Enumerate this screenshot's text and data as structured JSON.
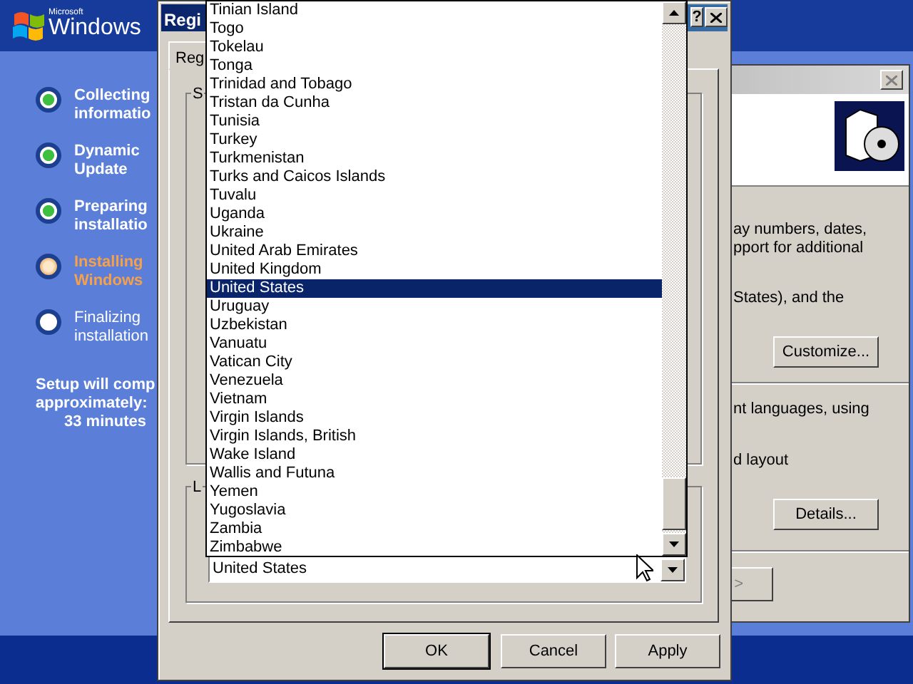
{
  "header": {
    "logo_small": "Microsoft",
    "logo": "Windows"
  },
  "steps": [
    {
      "lines": [
        "Collecting",
        "informatio"
      ],
      "kind": "done"
    },
    {
      "lines": [
        "Dynamic",
        "Update"
      ],
      "kind": "done"
    },
    {
      "lines": [
        "Preparing",
        "installatio"
      ],
      "kind": "done"
    },
    {
      "lines": [
        "Installing",
        "Windows"
      ],
      "kind": "current"
    },
    {
      "lines": [
        "Finalizing",
        "installation"
      ],
      "kind": "pending"
    }
  ],
  "estimate": [
    "Setup will comp",
    "approximately:",
    "33 minutes"
  ],
  "back_window": {
    "texts": [
      "ay numbers, dates,",
      "pport for additional",
      "States), and the"
    ],
    "customize": "Customize...",
    "texts2": [
      "nt languages, using",
      "d layout"
    ],
    "details": "Details...",
    "next": ">"
  },
  "dialog": {
    "title": "Regi",
    "help": "?",
    "tab": "Reg",
    "group_labels": [
      "S",
      "L"
    ],
    "combo_value": "United States",
    "list": [
      {
        "text": "Tinian Island",
        "selected": false
      },
      {
        "text": "Togo",
        "selected": false
      },
      {
        "text": "Tokelau",
        "selected": false
      },
      {
        "text": "Tonga",
        "selected": false
      },
      {
        "text": "Trinidad and Tobago",
        "selected": false
      },
      {
        "text": "Tristan da Cunha",
        "selected": false
      },
      {
        "text": "Tunisia",
        "selected": false
      },
      {
        "text": "Turkey",
        "selected": false
      },
      {
        "text": "Turkmenistan",
        "selected": false
      },
      {
        "text": "Turks and Caicos Islands",
        "selected": false
      },
      {
        "text": "Tuvalu",
        "selected": false
      },
      {
        "text": "Uganda",
        "selected": false
      },
      {
        "text": "Ukraine",
        "selected": false
      },
      {
        "text": "United Arab Emirates",
        "selected": false
      },
      {
        "text": "United Kingdom",
        "selected": false
      },
      {
        "text": "United States",
        "selected": true
      },
      {
        "text": "Uruguay",
        "selected": false
      },
      {
        "text": "Uzbekistan",
        "selected": false
      },
      {
        "text": "Vanuatu",
        "selected": false
      },
      {
        "text": "Vatican City",
        "selected": false
      },
      {
        "text": "Venezuela",
        "selected": false
      },
      {
        "text": "Vietnam",
        "selected": false
      },
      {
        "text": "Virgin Islands",
        "selected": false
      },
      {
        "text": "Virgin Islands, British",
        "selected": false
      },
      {
        "text": "Wake Island",
        "selected": false
      },
      {
        "text": "Wallis and Futuna",
        "selected": false
      },
      {
        "text": "Yemen",
        "selected": false
      },
      {
        "text": "Yugoslavia",
        "selected": false
      },
      {
        "text": "Zambia",
        "selected": false
      },
      {
        "text": "Zimbabwe",
        "selected": false
      }
    ],
    "buttons": [
      "OK",
      "Cancel",
      "Apply"
    ]
  }
}
